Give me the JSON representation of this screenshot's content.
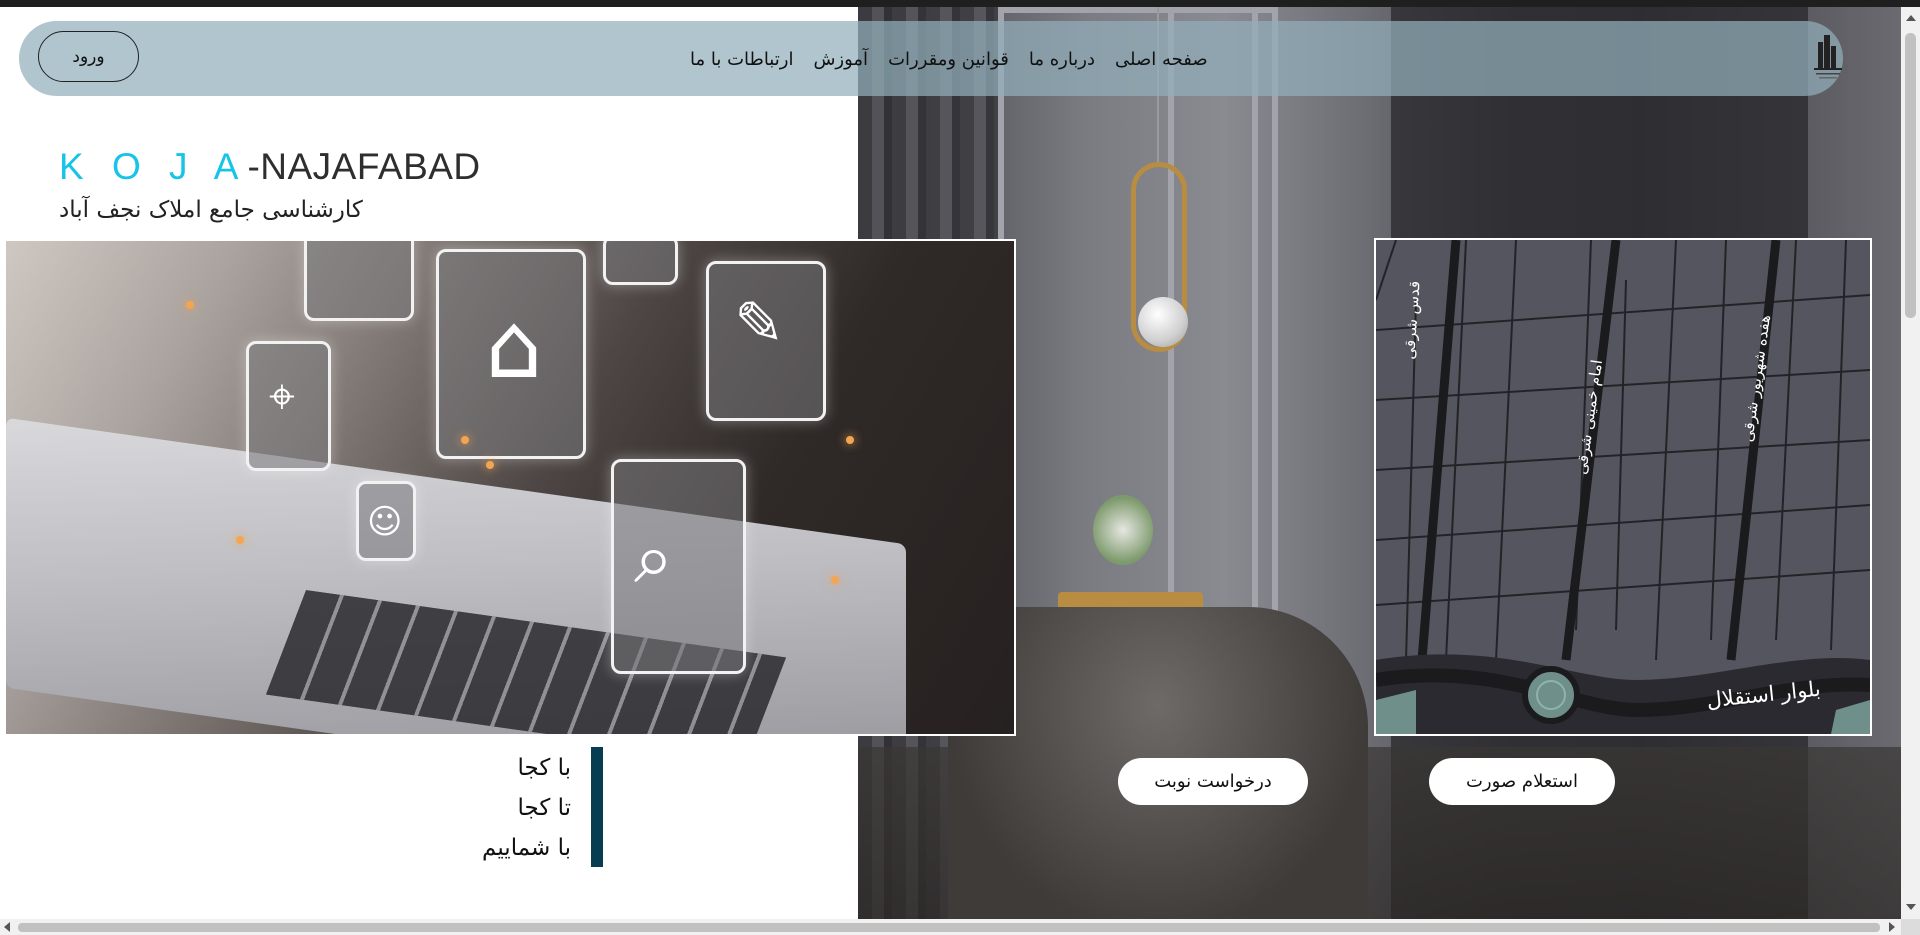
{
  "nav": {
    "login_label": "ورود",
    "links": [
      {
        "label": "صفحه اصلی"
      },
      {
        "label": "درباره ما"
      },
      {
        "label": "قوانین ومقررات"
      },
      {
        "label": "آموزش"
      },
      {
        "label": "ارتباطات با ما"
      }
    ],
    "logo_icon": "building-logo-icon"
  },
  "brand": {
    "accent": "K O J A",
    "rest": "-NAJAFABAD",
    "tagline": "کارشناسی جامع املاک نجف آباد",
    "accent_color": "#17c4e8"
  },
  "slogan": {
    "lines": [
      "با کجا",
      "تا کجا",
      "با شماییم"
    ],
    "bar_color": "#073d52"
  },
  "map": {
    "streets": [
      "قدس شرقی",
      "امام خمینی شرقی",
      "هفده شهریور شرقی",
      "بلوار استقلال"
    ]
  },
  "actions": {
    "appointment_label": "درخواست نوبت",
    "inquiry_label": "استعلام صورت"
  },
  "colors": {
    "navbar": "#92aeba",
    "map_background": "#565660"
  }
}
